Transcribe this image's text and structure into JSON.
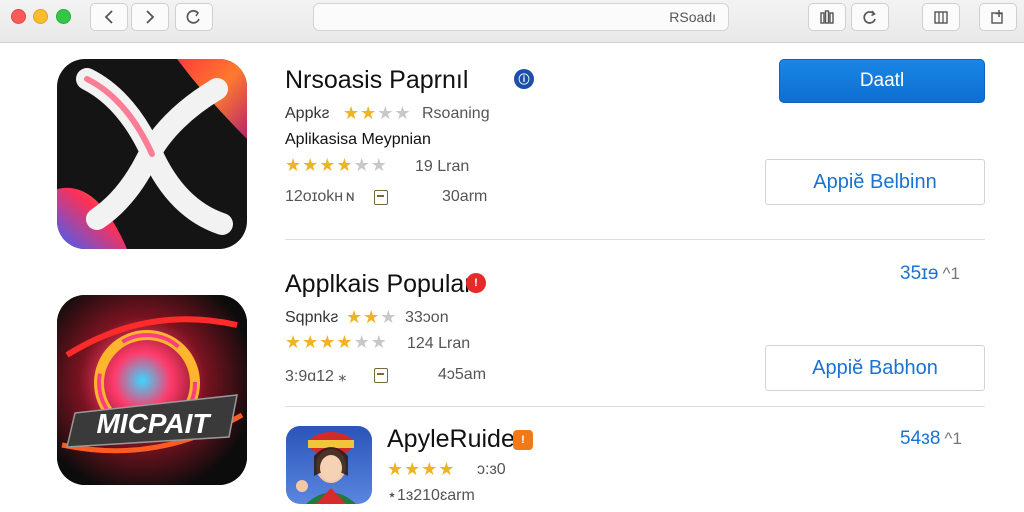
{
  "toolbar": {
    "url": "RSoadı",
    "icons": [
      "back-icon",
      "forward-icon",
      "reload-icon",
      "library-icon",
      "refresh-icon",
      "columns-icon",
      "add-tab-icon"
    ]
  },
  "apps": [
    {
      "title": "Nrsoasis Paprnıl",
      "meta1": "Appkƨ",
      "meta1_extra": "Rsoaning",
      "stars_a": 2,
      "subtitle": "Aplikasisa Meypnian",
      "stars_b": 4,
      "rating_text": "19 Lran",
      "stat": "12ᴏɪᴏkʜ ɴ",
      "stat2": "30arm",
      "primary_button": "Daatl",
      "secondary_button": "Appiĕ Belbinn"
    },
    {
      "title": "Applkais Popular",
      "meta1": "Sqpnkƨ",
      "meta1_extra": "33ɔon",
      "stars_a": 2,
      "stars_b": 4,
      "rating_text": "124 Lran",
      "stat": "3:9ɑ12 ⁎",
      "stat2": "4ɔ5am",
      "icon_text": "MICPAIT",
      "price": "35ɪɘ",
      "secondary_button": "Appiĕ Babhon"
    },
    {
      "title": "ApyleRuide",
      "meta1": "ɔ:ɜ0",
      "stars_a": 4,
      "rating_text": "⋆1ɜ210ɛarm",
      "price": "54ɜ8"
    }
  ],
  "colors": {
    "accent": "#1a73d0",
    "primary_button": "#0d6fd1",
    "star": "#f0b323"
  }
}
